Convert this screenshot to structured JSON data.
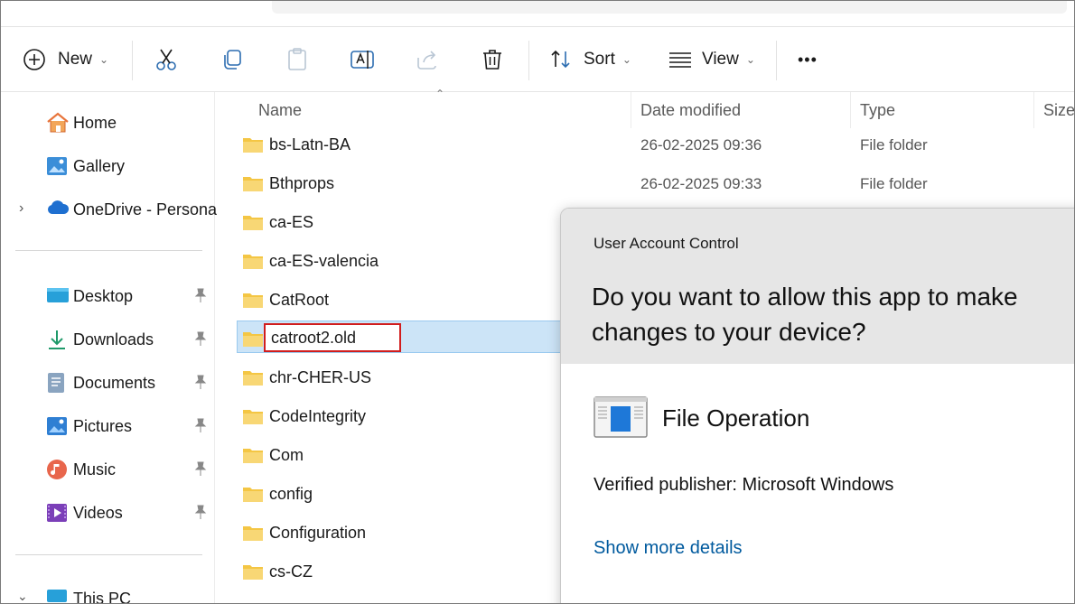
{
  "toolbar": {
    "new_label": "New",
    "sort_label": "Sort",
    "view_label": "View",
    "more_label": "•••"
  },
  "sidebar": {
    "items": [
      {
        "label": "Home"
      },
      {
        "label": "Gallery"
      },
      {
        "label": "OneDrive - Persona"
      },
      {
        "label": "Desktop"
      },
      {
        "label": "Downloads"
      },
      {
        "label": "Documents"
      },
      {
        "label": "Pictures"
      },
      {
        "label": "Music"
      },
      {
        "label": "Videos"
      },
      {
        "label": "This PC"
      }
    ]
  },
  "list": {
    "columns": {
      "name": "Name",
      "date": "Date modified",
      "type": "Type",
      "size": "Size"
    },
    "rows": [
      {
        "name": "bs-Latn-BA",
        "date": "26-02-2025 09:36",
        "type": "File folder"
      },
      {
        "name": "Bthprops",
        "date": "26-02-2025 09:33",
        "type": "File folder"
      },
      {
        "name": "ca-ES"
      },
      {
        "name": "ca-ES-valencia"
      },
      {
        "name": "CatRoot"
      },
      {
        "name": "catroot2.old"
      },
      {
        "name": "chr-CHER-US"
      },
      {
        "name": "CodeIntegrity"
      },
      {
        "name": "Com"
      },
      {
        "name": "config"
      },
      {
        "name": "Configuration"
      },
      {
        "name": "cs-CZ"
      }
    ]
  },
  "uac": {
    "title": "User Account Control",
    "question": "Do you want to allow this app to make changes to your device?",
    "app_name": "File Operation",
    "publisher": "Verified publisher: Microsoft Windows",
    "details_link": "Show more details"
  },
  "colors": {
    "selection": "#cce4f7",
    "rename_border": "#d11d1d",
    "link": "#005a9e",
    "folder": "#f4c644"
  }
}
